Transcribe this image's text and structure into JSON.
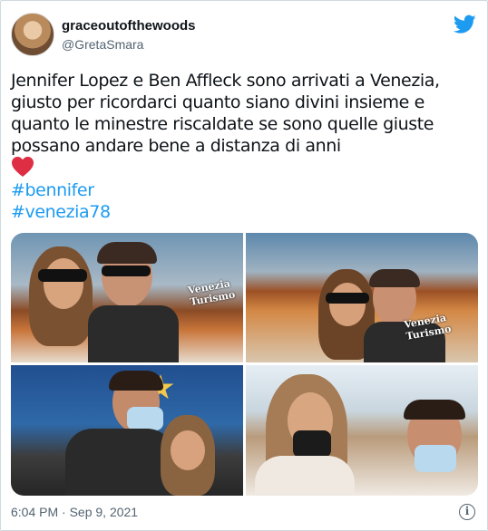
{
  "tweet": {
    "display_name": "graceoutofthewoods",
    "handle": "@GretaSmara",
    "text": "Jennifer Lopez e Ben Affleck sono arrivati a Venezia, giusto per ricordarci quanto siano divini insieme e quanto le minestre riscaldate se sono quelle giuste possano andare bene a distanza di anni",
    "hashtags": [
      "#bennifer",
      "#venezia78"
    ],
    "timestamp": "6:04 PM · Sep 9, 2021",
    "info_symbol": "i"
  },
  "photo_signs": {
    "line1": "Venezia Turismo",
    "line2": "Venezia Turismo"
  },
  "colors": {
    "link": "#1d9bf0",
    "heart": "#e0245e",
    "twitter_blue": "#1d9bf0"
  },
  "icons": [
    "twitter-bird-icon",
    "red-heart-emoji",
    "info-icon"
  ]
}
